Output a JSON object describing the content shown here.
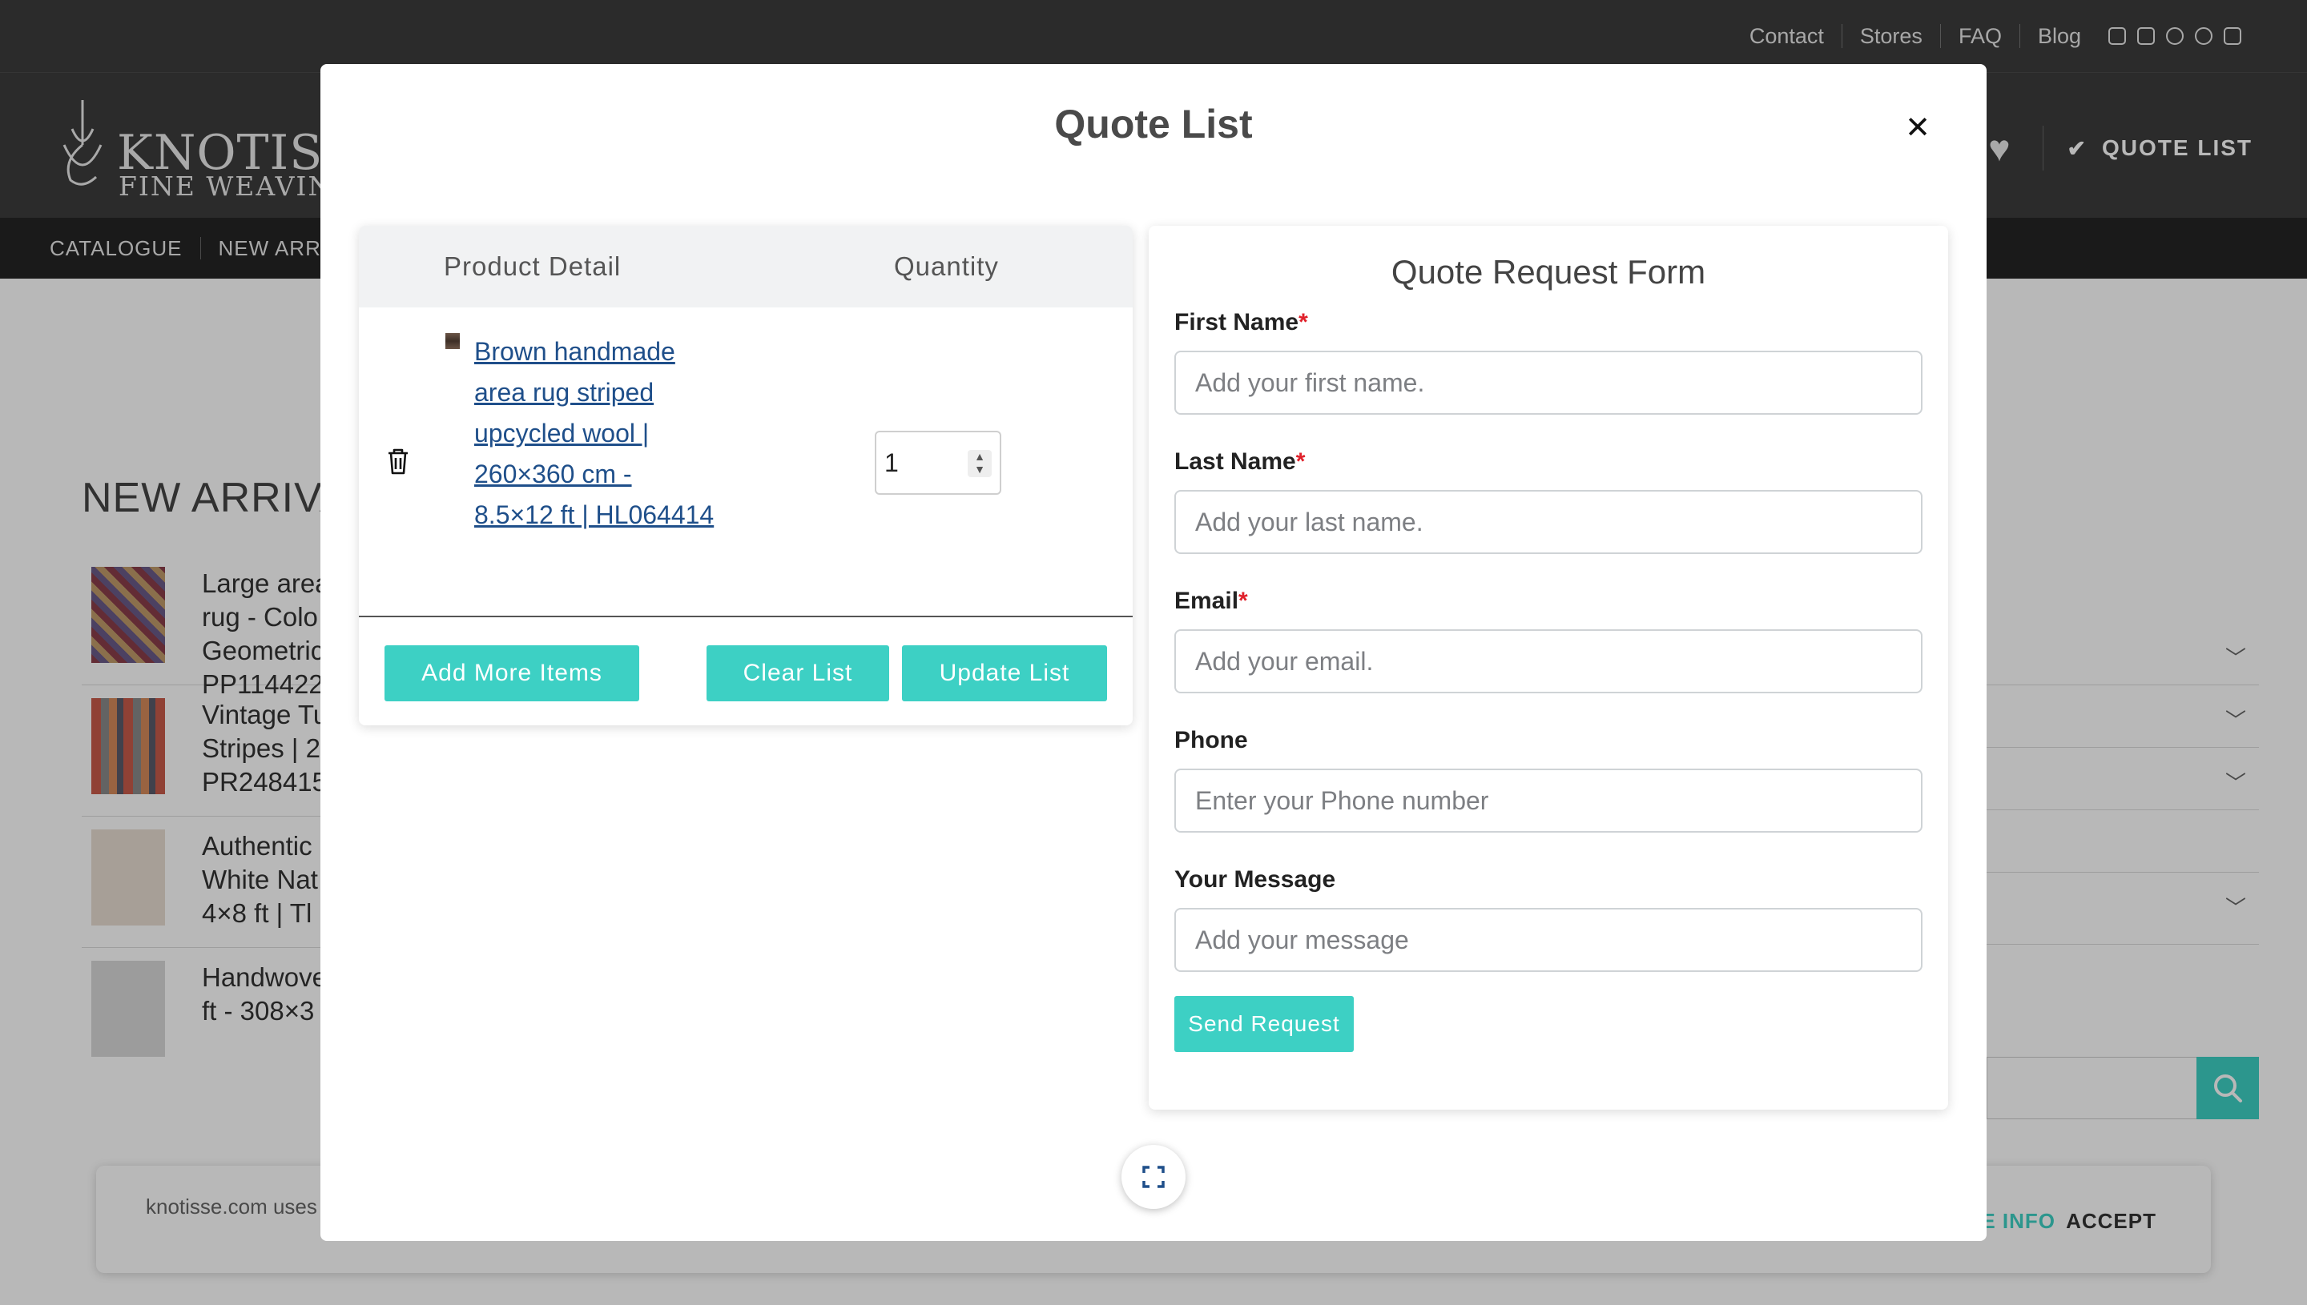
{
  "topbar": {
    "links": [
      "Contact",
      "Stores",
      "FAQ",
      "Blog"
    ],
    "social_icons": [
      "instagram-icon",
      "mail-icon",
      "phone-icon",
      "pinterest-icon",
      "youtube-icon"
    ]
  },
  "header": {
    "logo_text": "KNOTISSE",
    "logo_sub": "FINE WEAVING",
    "wishlist_icon": "heart-icon",
    "quote_list_label": "QUOTE LIST",
    "quote_list_icon": "check-icon"
  },
  "nav": {
    "items": [
      "CATALOGUE",
      "NEW ARRIVALS"
    ]
  },
  "page": {
    "section_title": "NEW ARRIVA",
    "products": [
      {
        "text": "Large area\nrug - Colo\nGeometric\nPP114422"
      },
      {
        "text": "Vintage Tu\nStripes | 2\nPR248415"
      },
      {
        "text": "Authentic\nWhite Nat\n4×8 ft | Tl"
      },
      {
        "text": "Handwove\nft - 308×3"
      }
    ]
  },
  "cookie": {
    "text": "knotisse.com uses",
    "more_info": "E INFO",
    "accept": "ACCEPT"
  },
  "modal": {
    "title": "Quote List",
    "close_icon": "close-icon",
    "expand_icon": "expand-icon",
    "list": {
      "headers": {
        "product": "Product Detail",
        "quantity": "Quantity"
      },
      "items": [
        {
          "name": "Brown handmade area rug striped upcycled wool | 260×360 cm - 8.5×12 ft | HL064414",
          "quantity": "1",
          "delete_icon": "trash-icon"
        }
      ],
      "buttons": {
        "add_more": "Add More Items",
        "clear": "Clear List",
        "update": "Update List"
      }
    },
    "form": {
      "title": "Quote Request Form",
      "fields": [
        {
          "label": "First Name",
          "required": "*",
          "placeholder": "Add your first name."
        },
        {
          "label": "Last Name",
          "required": "*",
          "placeholder": "Add your last name."
        },
        {
          "label": "Email",
          "required": "*",
          "placeholder": "Add your email."
        },
        {
          "label": "Phone",
          "required": "",
          "placeholder": "Enter your Phone number"
        },
        {
          "label": "Your Message",
          "required": "",
          "placeholder": "Add your message"
        }
      ],
      "submit": "Send Request"
    }
  },
  "colors": {
    "accent": "#3dd0c4",
    "header_bg": "#3c3c3c",
    "nav_bg": "#252525",
    "link": "#1f4f8a",
    "required": "#e0202a"
  }
}
